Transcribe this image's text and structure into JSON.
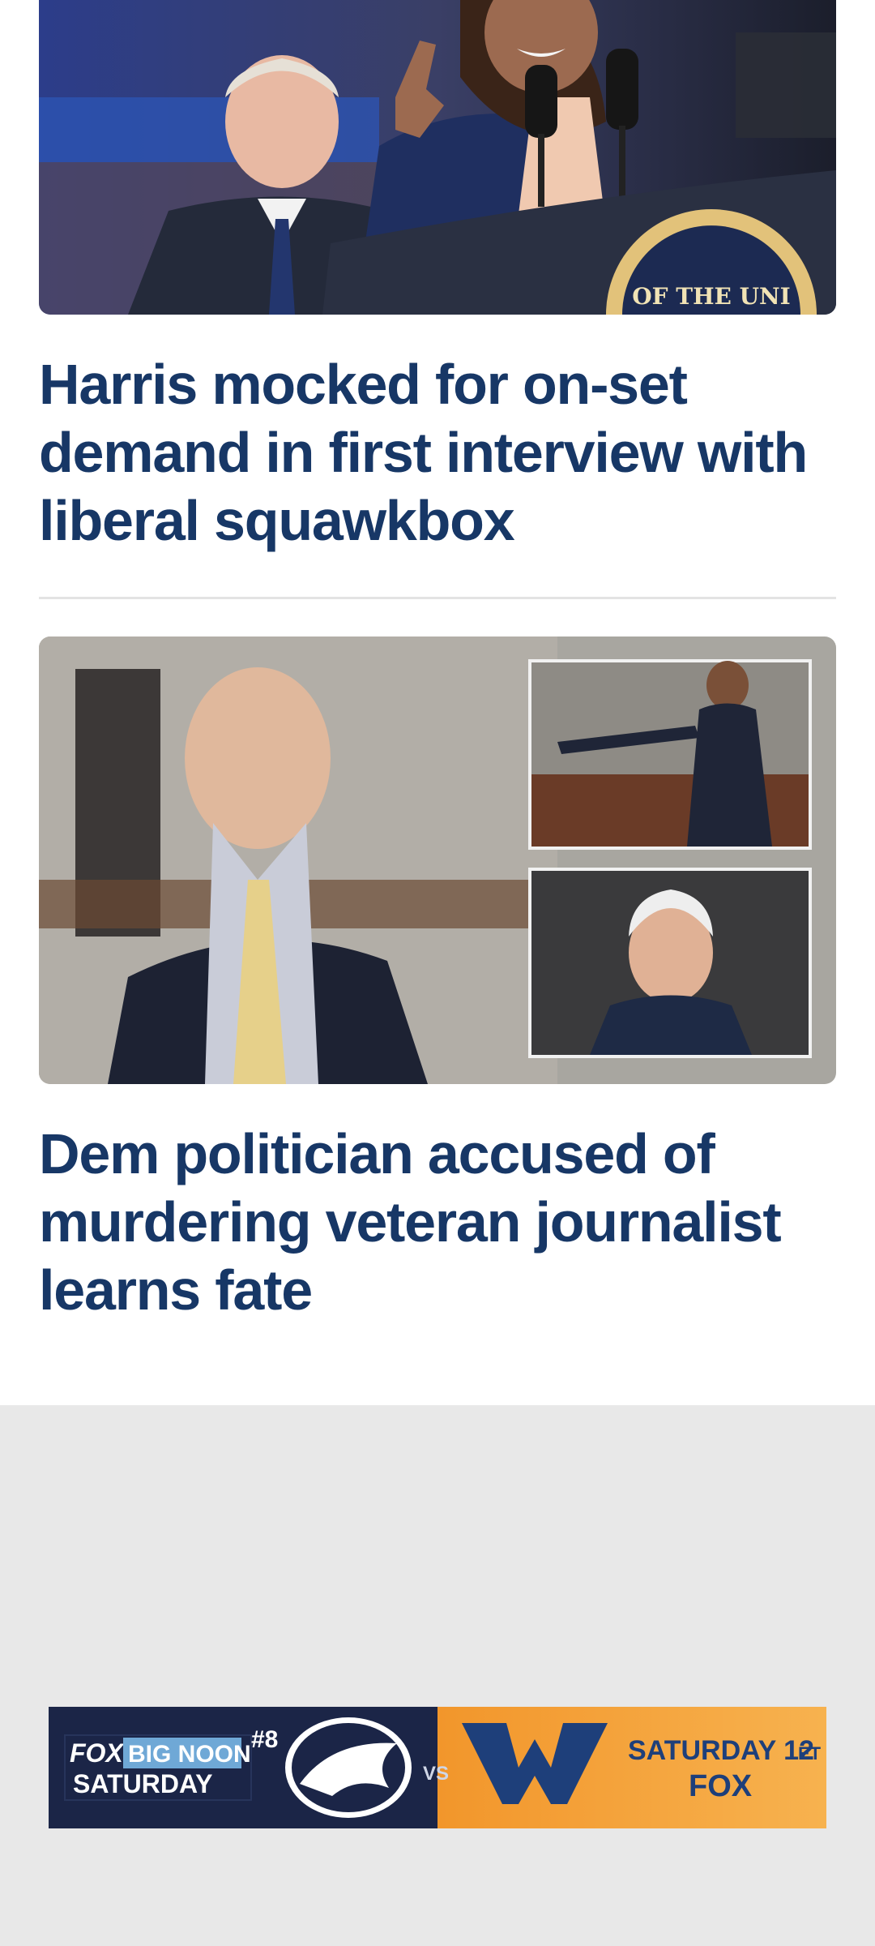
{
  "feed": {
    "stories": [
      {
        "headline": "Harris mocked for on-set demand in first interview with liberal squawkbox",
        "image_alt": "Harris pointing at podium with Walz behind",
        "podium_seal_text": "OF THE UNI"
      },
      {
        "headline": "Dem politician accused of murdering veteran journalist learns fate",
        "image_alt": "Defendant in courtroom with inset photos"
      }
    ]
  },
  "ad": {
    "brand": "FOX",
    "line1": "BIG NOON",
    "line2": "SATURDAY",
    "rank": "#8",
    "vs": "VS",
    "time": "SATURDAY 12",
    "time_suffix": "ET",
    "network": "FOX",
    "colors": {
      "left": "#1b2547",
      "right": "#f4a33a",
      "wvu_blue": "#1e3f7a"
    }
  },
  "colors": {
    "headline": "#173766",
    "ad_bg": "#e8e8e8"
  }
}
